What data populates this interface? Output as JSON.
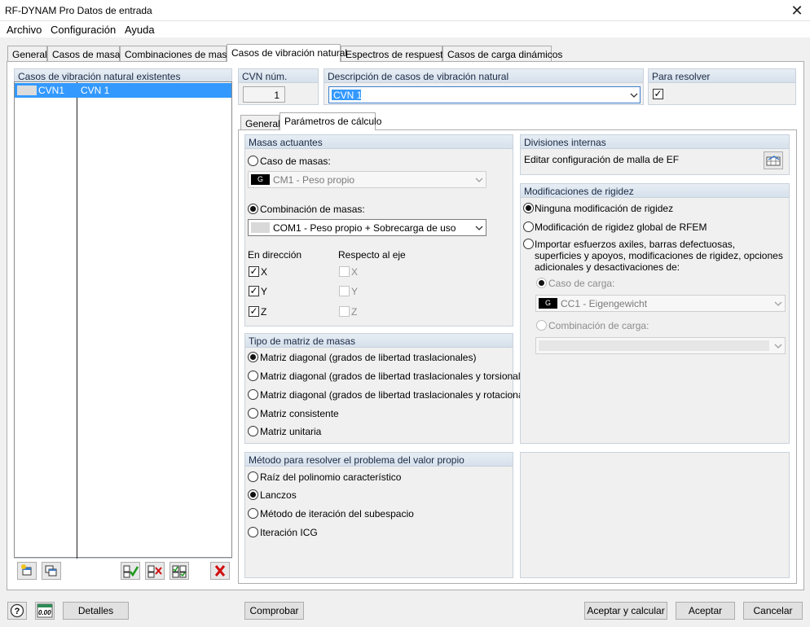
{
  "window": {
    "title": "RF-DYNAM Pro Datos de entrada"
  },
  "menu": [
    "Archivo",
    "Configuración",
    "Ayuda"
  ],
  "tabs": [
    "General",
    "Casos de masas",
    "Combinaciones de masas",
    "Casos de vibración natural",
    "Espectros de respuesta",
    "Casos de carga dinámicos"
  ],
  "active_tab": "Casos de vibración natural",
  "left_list": {
    "header": "Casos de vibración natural existentes",
    "rows": [
      {
        "id": "CVN1",
        "name": "CVN 1"
      }
    ]
  },
  "cvn": {
    "label": "CVN núm.",
    "value": "1"
  },
  "description": {
    "label": "Descripción de casos de vibración natural",
    "value": "CVN 1"
  },
  "solve": {
    "label": "Para resolver",
    "checked": true
  },
  "subtabs": [
    "General",
    "Parámetros de cálculo"
  ],
  "masses": {
    "title": "Masas actuantes",
    "mass_case_label": "Caso de masas:",
    "mass_case_chip": "G",
    "mass_case_value": "CM1 - Peso propio",
    "mass_combo_label": "Combinación de masas:",
    "mass_combo_value": "COM1 - Peso propio + Sobrecarga de uso",
    "direction_label": "En dirección",
    "axis_label": "Respecto al eje",
    "x": "X",
    "y": "Y",
    "z": "Z"
  },
  "matrix": {
    "title": "Tipo de matriz de masas",
    "options": [
      "Matriz diagonal (grados de libertad traslacionales)",
      "Matriz diagonal (grados de libertad traslacionales y torsionales)",
      "Matriz diagonal (grados de libertad traslacionales y rotacionales)",
      "Matriz consistente",
      "Matriz unitaria"
    ]
  },
  "method": {
    "title": "Método para resolver el problema del valor propio",
    "options": [
      "Raíz del polinomio característico",
      "Lanczos",
      "Método de iteración del subespacio",
      "Iteración ICG"
    ]
  },
  "divisions": {
    "title": "Divisiones internas",
    "text": "Editar configuración de malla de EF"
  },
  "stiffness": {
    "title": "Modificaciones de rigidez",
    "option1": "Ninguna modificación de rigidez",
    "option2": "Modificación de rigidez global de RFEM",
    "option3": "Importar esfuerzos axiles, barras defectuosas, superficies y apoyos, modificaciones de rigidez, opciones adicionales y desactivaciones de:",
    "load_case_label": "Caso de carga:",
    "load_case_chip": "G",
    "load_case_value": "CC1 - Eigengewicht",
    "load_combo_label": "Combinación de carga:"
  },
  "buttons": {
    "details": "Detalles",
    "check": "Comprobar",
    "accept_calc": "Aceptar y calcular",
    "accept": "Aceptar",
    "cancel": "Cancelar"
  },
  "units_icon": "0.00",
  "colors": {
    "selection": "#3399ff",
    "panel_header": "#dde6f0",
    "delete_red": "#d01010"
  }
}
